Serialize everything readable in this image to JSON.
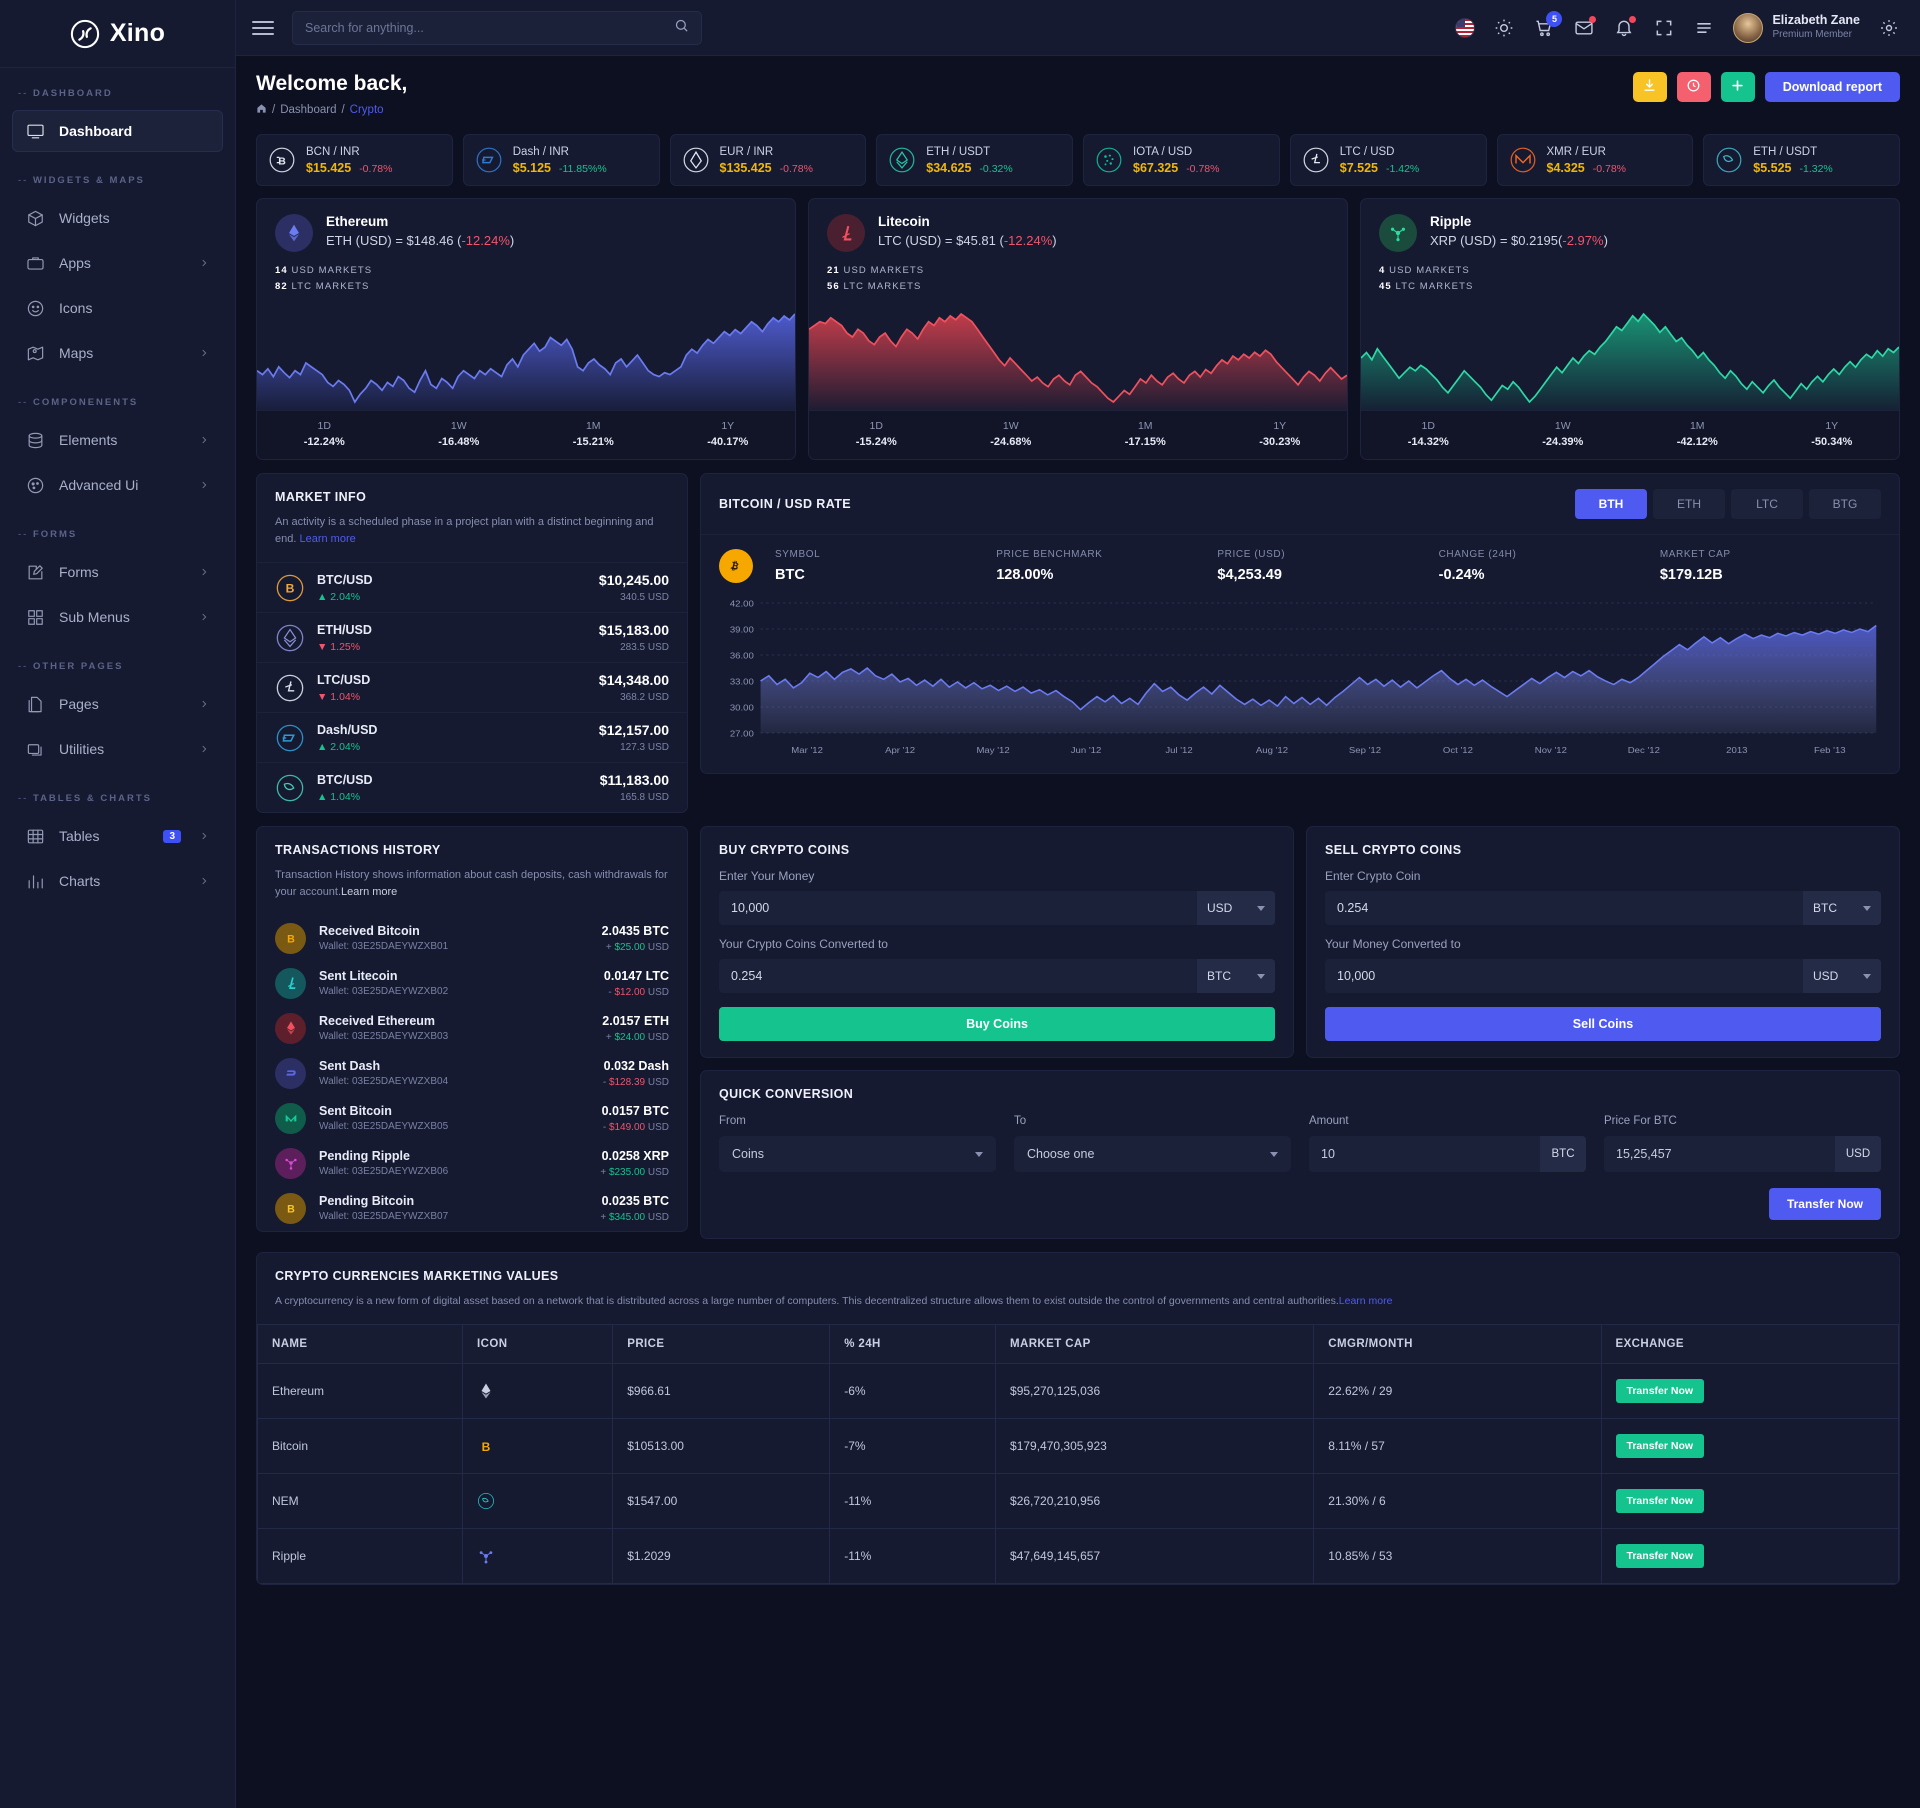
{
  "brand": {
    "name": "Xino",
    "logo_icon": "xino-logo-icon"
  },
  "sidebar": {
    "sections": [
      {
        "label": "DASHBOARD",
        "items": [
          {
            "label": "Dashboard",
            "icon": "monitor-icon",
            "active": true,
            "chevron": false
          }
        ]
      },
      {
        "label": "WIDGETS & MAPS",
        "items": [
          {
            "label": "Widgets",
            "icon": "box-icon",
            "chevron": false
          },
          {
            "label": "Apps",
            "icon": "briefcase-icon",
            "chevron": true
          },
          {
            "label": "Icons",
            "icon": "smiley-icon",
            "chevron": false
          },
          {
            "label": "Maps",
            "icon": "map-pin-icon",
            "chevron": true
          }
        ]
      },
      {
        "label": "COMPONENENTS",
        "items": [
          {
            "label": "Elements",
            "icon": "database-icon",
            "chevron": true
          },
          {
            "label": "Advanced Ui",
            "icon": "palette-icon",
            "chevron": true
          }
        ]
      },
      {
        "label": "FORMS",
        "items": [
          {
            "label": "Forms",
            "icon": "edit-square-icon",
            "chevron": true
          },
          {
            "label": "Sub Menus",
            "icon": "grid-icon",
            "chevron": true
          }
        ]
      },
      {
        "label": "OTHER PAGES",
        "items": [
          {
            "label": "Pages",
            "icon": "pages-icon",
            "chevron": true
          },
          {
            "label": "Utilities",
            "icon": "layers-icon",
            "chevron": true
          }
        ]
      },
      {
        "label": "TABLES & CHARTS",
        "items": [
          {
            "label": "Tables",
            "icon": "table-icon",
            "badge": "3",
            "chevron": true
          },
          {
            "label": "Charts",
            "icon": "bar-chart-icon",
            "chevron": true
          }
        ]
      }
    ]
  },
  "topbar": {
    "search_placeholder": "Search for anything...",
    "search_value": "",
    "cart_count": "5",
    "user_name": "Elizabeth Zane",
    "user_role": "Premium Member",
    "icons": [
      "menu-icon",
      "search-icon",
      "flag-us-icon",
      "brightness-icon",
      "cart-icon",
      "mail-icon",
      "bell-icon",
      "fullscreen-icon",
      "list-icon",
      "avatar",
      "gear-icon"
    ]
  },
  "page": {
    "welcome": "Welcome back,",
    "breadcrumb": {
      "home_icon": "home-icon",
      "parent": "Dashboard",
      "current": "Crypto"
    },
    "actions": {
      "download_icon": "download-icon",
      "clock_icon": "clock-icon",
      "plus_icon": "plus-icon",
      "download_report": "Download report"
    }
  },
  "tickers": [
    {
      "pair": "BCN / INR",
      "price": "$15.425",
      "change": "-0.78%",
      "dir": "neg",
      "icon": "bytecoin-icon",
      "color": "#e8eaf2"
    },
    {
      "pair": "Dash / INR",
      "price": "$5.125",
      "change": "-11.85%%",
      "dir": "pos",
      "icon": "dash-icon",
      "color": "#2f7bd4"
    },
    {
      "pair": "EUR / INR",
      "price": "$135.425",
      "change": "-0.78%",
      "dir": "neg",
      "icon": "eos-icon",
      "color": "#e8eaf2"
    },
    {
      "pair": "ETH / USDT",
      "price": "$34.625",
      "change": "-0.32%",
      "dir": "pos",
      "icon": "ethereum-ring-icon",
      "color": "#26c6a5"
    },
    {
      "pair": "IOTA / USD",
      "price": "$67.325",
      "change": "-0.78%",
      "dir": "neg",
      "icon": "iota-icon",
      "color": "#0fbf96"
    },
    {
      "pair": "LTC / USD",
      "price": "$7.525",
      "change": "-1.42%",
      "dir": "pos",
      "icon": "litecoin-icon",
      "color": "#e8eaf2"
    },
    {
      "pair": "XMR / EUR",
      "price": "$4.325",
      "change": "-0.78%",
      "dir": "neg",
      "icon": "monero-icon",
      "color": "#f26822"
    },
    {
      "pair": "ETH / USDT",
      "price": "$5.525",
      "change": "-1.32%",
      "dir": "pos",
      "icon": "nem-icon",
      "color": "#3fb6c8"
    }
  ],
  "coin_cards": [
    {
      "name": "Ethereum",
      "rate_prefix": "ETH (USD) = $148.46 (",
      "rate_change": "-12.24%",
      "rate_suffix": ")",
      "icon": "ethereum-icon",
      "badge_bg": "#2b2f63",
      "line": "#6b7bf0",
      "fill": "#5866e8",
      "markets": [
        {
          "n": "14",
          "t": "USD MARKETS"
        },
        {
          "n": "82",
          "t": "LTC MARKETS"
        }
      ],
      "periods": [
        {
          "k": "1D",
          "v": "-12.24%"
        },
        {
          "k": "1W",
          "v": "-16.48%"
        },
        {
          "k": "1M",
          "v": "-15.21%"
        },
        {
          "k": "1Y",
          "v": "-40.17%"
        }
      ],
      "points": [
        62,
        58,
        64,
        56,
        66,
        60,
        55,
        62,
        58,
        70,
        66,
        62,
        58,
        50,
        46,
        52,
        48,
        42,
        30,
        38,
        44,
        52,
        48,
        42,
        50,
        46,
        56,
        52,
        44,
        40,
        52,
        62,
        48,
        44,
        54,
        50,
        44,
        56,
        62,
        58,
        54,
        62,
        58,
        64,
        60,
        56,
        68,
        74,
        66,
        78,
        84,
        90,
        82,
        86,
        96,
        92,
        88,
        94,
        84,
        66,
        62,
        70,
        74,
        68,
        64,
        58,
        70,
        74,
        66,
        72,
        78,
        70,
        62,
        58,
        56,
        60,
        58,
        62,
        66,
        78,
        84,
        80,
        88,
        94,
        90,
        96,
        102,
        98,
        104,
        100,
        106,
        112,
        108,
        102,
        110,
        116,
        112,
        118,
        114,
        120
      ]
    },
    {
      "name": "Litecoin",
      "rate_prefix": "LTC (USD) = $45.81 (",
      "rate_change": "-12.24%",
      "rate_suffix": ")",
      "icon": "litecoin-solid-icon",
      "badge_bg": "#4a2030",
      "line": "#f0515f",
      "fill": "#e0434f",
      "markets": [
        {
          "n": "21",
          "t": "USD MARKETS"
        },
        {
          "n": "56",
          "t": "LTC MARKETS"
        }
      ],
      "periods": [
        {
          "k": "1D",
          "v": "-15.24%"
        },
        {
          "k": "1W",
          "v": "-24.68%"
        },
        {
          "k": "1M",
          "v": "-17.15%"
        },
        {
          "k": "1Y",
          "v": "-30.23%"
        }
      ],
      "points": [
        104,
        108,
        112,
        110,
        116,
        112,
        108,
        100,
        96,
        104,
        100,
        92,
        88,
        96,
        100,
        92,
        86,
        96,
        104,
        100,
        94,
        104,
        112,
        108,
        116,
        112,
        118,
        114,
        120,
        116,
        112,
        104,
        96,
        88,
        80,
        72,
        66,
        74,
        68,
        62,
        56,
        50,
        54,
        48,
        44,
        52,
        56,
        50,
        46,
        56,
        60,
        54,
        48,
        44,
        38,
        32,
        28,
        34,
        40,
        36,
        44,
        52,
        48,
        56,
        50,
        46,
        54,
        58,
        52,
        48,
        56,
        60,
        54,
        62,
        58,
        66,
        72,
        68,
        76,
        72,
        78,
        74,
        80,
        76,
        82,
        78,
        70,
        64,
        58,
        52,
        46,
        54,
        60,
        56,
        50,
        58,
        64,
        58,
        52,
        56
      ]
    },
    {
      "name": "Ripple",
      "rate_prefix": "XRP (USD) = $0.2195(",
      "rate_change": "-2.97%",
      "rate_suffix": ")",
      "icon": "ripple-icon",
      "badge_bg": "#1b4b3c",
      "line": "#2fd9a5",
      "fill": "#1aa780",
      "markets": [
        {
          "n": "4",
          "t": "USD MARKETS"
        },
        {
          "n": "45",
          "t": "LTC MARKETS"
        }
      ],
      "periods": [
        {
          "k": "1D",
          "v": "-14.32%"
        },
        {
          "k": "1W",
          "v": "-24.39%"
        },
        {
          "k": "1M",
          "v": "-42.12%"
        },
        {
          "k": "1Y",
          "v": "-50.34%"
        }
      ],
      "points": [
        78,
        84,
        76,
        88,
        80,
        72,
        64,
        56,
        62,
        68,
        64,
        70,
        66,
        60,
        54,
        46,
        40,
        48,
        56,
        64,
        58,
        52,
        46,
        38,
        32,
        40,
        48,
        44,
        52,
        46,
        38,
        30,
        36,
        44,
        52,
        60,
        68,
        62,
        70,
        78,
        72,
        80,
        86,
        82,
        90,
        96,
        104,
        112,
        108,
        116,
        124,
        118,
        126,
        120,
        114,
        106,
        112,
        104,
        96,
        100,
        92,
        86,
        78,
        84,
        76,
        70,
        62,
        56,
        64,
        58,
        50,
        44,
        52,
        46,
        40,
        48,
        54,
        46,
        40,
        34,
        42,
        50,
        44,
        52,
        58,
        52,
        60,
        66,
        60,
        68,
        74,
        68,
        76,
        82,
        78,
        86,
        80,
        88,
        84,
        90
      ]
    }
  ],
  "market_info": {
    "title": "MARKET INFO",
    "desc": "An activity is a scheduled phase in a project plan with a distinct beginning and end.",
    "link": "Learn more",
    "rows": [
      {
        "pair": "BTC/USD",
        "change": "2.04%",
        "dir": "pos",
        "price": "$10,245.00",
        "vol": "340.5 USD",
        "icon": "bitcoin-ring-icon",
        "color": "#f2a73b"
      },
      {
        "pair": "ETH/USD",
        "change": "1.25%",
        "dir": "neg",
        "price": "$15,183.00",
        "vol": "283.5 USD",
        "icon": "ethereum-ring2-icon",
        "color": "#8a8fd6"
      },
      {
        "pair": "LTC/USD",
        "change": "1.04%",
        "dir": "neg",
        "price": "$14,348.00",
        "vol": "368.2 USD",
        "icon": "litecoin-ring-icon",
        "color": "#dfe3ef"
      },
      {
        "pair": "Dash/USD",
        "change": "2.04%",
        "dir": "pos",
        "price": "$12,157.00",
        "vol": "127.3 USD",
        "icon": "dash-ring-icon",
        "color": "#2f9bd4"
      },
      {
        "pair": "BTC/USD",
        "change": "1.04%",
        "dir": "pos",
        "price": "$11,183.00",
        "vol": "165.8 USD",
        "icon": "nem-ring-icon",
        "color": "#45c8b0"
      }
    ]
  },
  "rate_panel": {
    "title": "BITCOIN / USD RATE",
    "tabs": [
      {
        "label": "BTH",
        "selected": true
      },
      {
        "label": "ETH",
        "selected": false
      },
      {
        "label": "LTC",
        "selected": false
      },
      {
        "label": "BTG",
        "selected": false
      }
    ],
    "stats": [
      {
        "k": "SYMBOL",
        "v": "BTC"
      },
      {
        "k": "PRICE BENCHMARK",
        "v": "128.00%"
      },
      {
        "k": "PRICE (USD)",
        "v": "$4,253.49"
      },
      {
        "k": "CHANGE (24H)",
        "v": "-0.24%"
      },
      {
        "k": "MARKET CAP",
        "v": "$179.12B"
      }
    ]
  },
  "chart_data": {
    "type": "area",
    "title": "BITCOIN / USD RATE",
    "xlabel": "",
    "ylabel": "",
    "ylim": [
      27.0,
      42.0
    ],
    "yticks": [
      "42.00",
      "39.00",
      "36.00",
      "33.00",
      "30.00",
      "27.00"
    ],
    "xticks": [
      "Mar '12",
      "Apr '12",
      "May '12",
      "Jun '12",
      "Jul '12",
      "Aug '12",
      "Sep '12",
      "Oct '12",
      "Nov '12",
      "Dec '12",
      "2013",
      "Feb '13"
    ],
    "grid": true,
    "legend": null,
    "series": [
      {
        "name": "BTC/USD",
        "values": [
          33.0,
          33.6,
          32.6,
          33.2,
          32.2,
          32.8,
          33.9,
          33.4,
          34.1,
          33.2,
          34.0,
          34.4,
          33.8,
          34.5,
          33.6,
          33.2,
          33.8,
          32.9,
          33.3,
          32.5,
          33.1,
          32.4,
          33.2,
          32.3,
          32.9,
          32.2,
          32.8,
          32.1,
          32.5,
          31.9,
          32.4,
          31.8,
          32.3,
          31.6,
          32.0,
          31.4,
          31.9,
          31.2,
          30.6,
          29.7,
          30.5,
          31.2,
          30.6,
          31.3,
          30.4,
          31.0,
          30.3,
          31.6,
          32.7,
          31.8,
          32.3,
          31.4,
          30.8,
          31.6,
          32.3,
          31.5,
          32.5,
          31.7,
          30.9,
          30.3,
          30.9,
          30.2,
          30.8,
          30.1,
          31.2,
          30.4,
          31.1,
          30.3,
          31.0,
          30.2,
          31.1,
          31.8,
          32.6,
          33.4,
          32.6,
          33.2,
          32.4,
          33.1,
          32.3,
          33.0,
          32.2,
          32.9,
          33.6,
          34.2,
          33.3,
          32.6,
          33.2,
          32.5,
          33.1,
          32.4,
          31.8,
          31.2,
          31.9,
          32.6,
          33.3,
          32.7,
          33.4,
          34.0,
          33.4,
          34.1,
          33.6,
          34.2,
          33.5,
          33.0,
          32.6,
          33.2,
          32.8,
          33.4,
          34.2,
          35.0,
          35.8,
          36.5,
          37.2,
          36.6,
          37.4,
          38.1,
          37.4,
          38.0,
          37.3,
          37.9,
          38.4,
          37.9,
          38.3,
          38.0,
          38.5,
          38.2,
          38.6,
          38.3,
          38.7,
          38.4,
          38.8,
          38.5,
          38.9,
          38.6,
          39.0,
          38.7,
          39.4
        ]
      }
    ]
  },
  "transactions": {
    "title": "TRANSACTIONS HISTORY",
    "desc": "Transaction History shows information about cash deposits, cash withdrawals for your account.",
    "link": "Learn more",
    "rows": [
      {
        "title": "Received Bitcoin",
        "wallet": "Wallet: 03E25DAEYWZXB01",
        "amount": "2.0435 BTC",
        "sign": "+",
        "usd": "$25.00",
        "unit": "USD",
        "dir": "pos",
        "icon": "bitcoin-icon",
        "bg": "#7a5a12",
        "fg": "#f7a800"
      },
      {
        "title": "Sent Litecoin",
        "wallet": "Wallet: 03E25DAEYWZXB02",
        "amount": "0.0147 LTC",
        "sign": "-",
        "usd": "$12.00",
        "unit": "USD",
        "dir": "neg",
        "icon": "litecoin-solid-icon",
        "bg": "#14575c",
        "fg": "#2ad1d1"
      },
      {
        "title": "Received Ethereum",
        "wallet": "Wallet: 03E25DAEYWZXB03",
        "amount": "2.0157 ETH",
        "sign": "+",
        "usd": "$24.00",
        "unit": "USD",
        "dir": "pos",
        "icon": "ethereum-icon",
        "bg": "#5c1f2b",
        "fg": "#f05060"
      },
      {
        "title": "Sent Dash",
        "wallet": "Wallet: 03E25DAEYWZXB04",
        "amount": "0.032 Dash",
        "sign": "-",
        "usd": "$128.39",
        "unit": "USD",
        "dir": "neg",
        "icon": "dash-solid-icon",
        "bg": "#2b2f63",
        "fg": "#5866e8"
      },
      {
        "title": "Sent Bitcoin",
        "wallet": "Wallet: 03E25DAEYWZXB05",
        "amount": "0.0157 BTC",
        "sign": "-",
        "usd": "$149.00",
        "unit": "USD",
        "dir": "neg",
        "icon": "monero-solid-icon",
        "bg": "#0f5c4a",
        "fg": "#18c99a"
      },
      {
        "title": "Pending Ripple",
        "wallet": "Wallet: 03E25DAEYWZXB06",
        "amount": "0.0258 XRP",
        "sign": "+",
        "usd": "$235.00",
        "unit": "USD",
        "dir": "pos",
        "icon": "ripple-icon",
        "bg": "#5c1f5c",
        "fg": "#d94ad9"
      },
      {
        "title": "Pending Bitcoin",
        "wallet": "Wallet: 03E25DAEYWZXB07",
        "amount": "0.0235 BTC",
        "sign": "+",
        "usd": "$345.00",
        "unit": "USD",
        "dir": "pos",
        "icon": "bitcoin-icon",
        "bg": "#7a5a12",
        "fg": "#f7c325"
      }
    ]
  },
  "buy_panel": {
    "title": "BUY CRYPTO COINS",
    "label1": "Enter Your Money",
    "value1": "10,000",
    "unit1": "USD",
    "label2": "Your Crypto Coins Converted to",
    "value2": "0.254",
    "unit2": "BTC",
    "button": "Buy Coins"
  },
  "sell_panel": {
    "title": "SELL CRYPTO COINS",
    "label1": "Enter Crypto Coin",
    "value1": "0.254",
    "unit1": "BTC",
    "label2": "Your Money Converted to",
    "value2": "10,000",
    "unit2": "USD",
    "button": "Sell Coins"
  },
  "quick_conversion": {
    "title": "QUICK CONVERSION",
    "from_label": "From",
    "from_value": "Coins",
    "to_label": "To",
    "to_value": "Choose one",
    "amount_label": "Amount",
    "amount_value": "10",
    "amount_unit": "BTC",
    "price_label": "Price For BTC",
    "price_value": "15,25,457",
    "price_unit": "USD",
    "button": "Transfer Now"
  },
  "marketing_table": {
    "title": "CRYPTO CURRENCIES MARKETING VALUES",
    "desc": "A cryptocurrency is a new form of digital asset based on a network that is distributed across a large number of computers. This decentralized structure allows them to exist outside the control of governments and central authorities.",
    "link": "Learn more",
    "columns": [
      "NAME",
      "ICON",
      "PRICE",
      "% 24H",
      "MARKET CAP",
      "CMGR/MONTH",
      "EXCHANGE"
    ],
    "rows": [
      {
        "name": "Ethereum",
        "icon": "ethereum-icon",
        "icon_color": "#c9cfe0",
        "price": "$966.61",
        "pct24h": "-6%",
        "market_cap": "$95,270,125,036",
        "cmgr": "22.62% / 29",
        "action": "Transfer Now"
      },
      {
        "name": "Bitcoin",
        "icon": "bitcoin-icon",
        "icon_color": "#f7a800",
        "price": "$10513.00",
        "pct24h": "-7%",
        "market_cap": "$179,470,305,923",
        "cmgr": "8.11% / 57",
        "action": "Transfer Now"
      },
      {
        "name": "NEM",
        "icon": "nem-icon",
        "icon_color": "#2ad1d1",
        "price": "$1547.00",
        "pct24h": "-11%",
        "market_cap": "$26,720,210,956",
        "cmgr": "21.30% / 6",
        "action": "Transfer Now"
      },
      {
        "name": "Ripple",
        "icon": "ripple-icon",
        "icon_color": "#6b7bf0",
        "price": "$1.2029",
        "pct24h": "-11%",
        "market_cap": "$47,649,145,657",
        "cmgr": "10.85% / 53",
        "action": "Transfer Now"
      }
    ]
  },
  "colors": {
    "accent": "#4f5bf0",
    "positive": "#14c38e",
    "negative": "#f0556b",
    "warning": "#f2b705",
    "bg": "#0d1020",
    "panel": "#151a31"
  }
}
